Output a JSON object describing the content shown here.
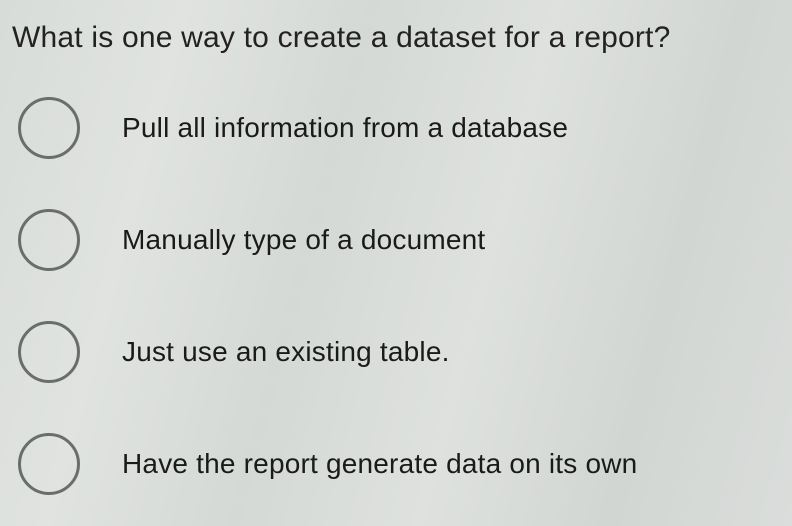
{
  "question": "What is one way to create a dataset for a report?",
  "options": [
    {
      "label": "Pull all information from a database"
    },
    {
      "label": "Manually type of a document"
    },
    {
      "label": "Just use an existing table."
    },
    {
      "label": "Have the report generate data on its own"
    }
  ]
}
